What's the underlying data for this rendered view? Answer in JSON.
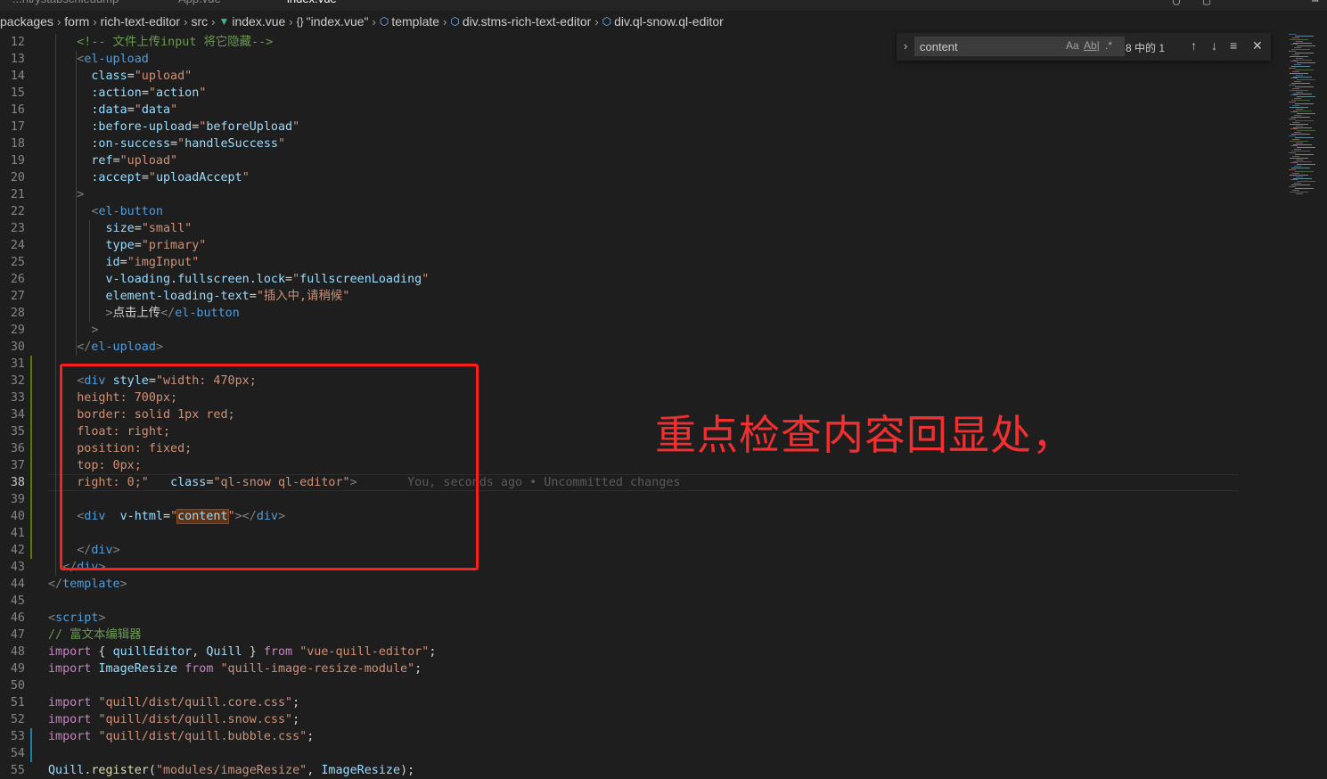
{
  "tabs": [
    {
      "label": "...nt/ystabschiedump",
      "active": false
    },
    {
      "label": "App.vue",
      "active": false
    },
    {
      "label": "index.vue",
      "active": true
    }
  ],
  "breadcrumb": [
    {
      "label": "packages",
      "icon": ""
    },
    {
      "label": "form",
      "icon": ""
    },
    {
      "label": "rich-text-editor",
      "icon": ""
    },
    {
      "label": "src",
      "icon": ""
    },
    {
      "label": "index.vue",
      "icon": "vue-icon"
    },
    {
      "label": "\"index.vue\"",
      "icon": "braces-icon"
    },
    {
      "label": "template",
      "icon": "cube-icon"
    },
    {
      "label": "div.stms-rich-text-editor",
      "icon": "cube-icon"
    },
    {
      "label": "div.ql-snow.ql-editor",
      "icon": "cube-icon"
    }
  ],
  "find": {
    "query": "content",
    "match_case": "Aa",
    "whole_word": "Ab|",
    "regex": ".*",
    "count": "8 中的 1",
    "prev": "↑",
    "next": "↓",
    "selection": "≡",
    "close": "✕"
  },
  "annotation": "重点检查内容回显处，",
  "current_line": 38,
  "lines": [
    {
      "n": 12,
      "tokens": [
        [
          "t-cmt",
          "    <!-- 文件上传input 将它隐藏-->"
        ]
      ]
    },
    {
      "n": 13,
      "tokens": [
        [
          "t-plain",
          "    "
        ],
        [
          "t-punct",
          "<"
        ],
        [
          "t-tag",
          "el-upload"
        ]
      ]
    },
    {
      "n": 14,
      "tokens": [
        [
          "t-plain",
          "      "
        ],
        [
          "t-attr",
          "class"
        ],
        [
          "t-plain",
          "="
        ],
        [
          "t-str",
          "\"upload\""
        ]
      ]
    },
    {
      "n": 15,
      "tokens": [
        [
          "t-plain",
          "      "
        ],
        [
          "t-attr",
          ":action"
        ],
        [
          "t-plain",
          "="
        ],
        [
          "t-str",
          "\""
        ],
        [
          "t-attr",
          "action"
        ],
        [
          "t-str",
          "\""
        ]
      ]
    },
    {
      "n": 16,
      "tokens": [
        [
          "t-plain",
          "      "
        ],
        [
          "t-attr",
          ":data"
        ],
        [
          "t-plain",
          "="
        ],
        [
          "t-str",
          "\""
        ],
        [
          "t-attr",
          "data"
        ],
        [
          "t-str",
          "\""
        ]
      ]
    },
    {
      "n": 17,
      "tokens": [
        [
          "t-plain",
          "      "
        ],
        [
          "t-attr",
          ":before-upload"
        ],
        [
          "t-plain",
          "="
        ],
        [
          "t-str",
          "\""
        ],
        [
          "t-attr",
          "beforeUpload"
        ],
        [
          "t-str",
          "\""
        ]
      ]
    },
    {
      "n": 18,
      "tokens": [
        [
          "t-plain",
          "      "
        ],
        [
          "t-attr",
          ":on-success"
        ],
        [
          "t-plain",
          "="
        ],
        [
          "t-str",
          "\""
        ],
        [
          "t-attr",
          "handleSuccess"
        ],
        [
          "t-str",
          "\""
        ]
      ]
    },
    {
      "n": 19,
      "tokens": [
        [
          "t-plain",
          "      "
        ],
        [
          "t-attr",
          "ref"
        ],
        [
          "t-plain",
          "="
        ],
        [
          "t-str",
          "\"upload\""
        ]
      ]
    },
    {
      "n": 20,
      "tokens": [
        [
          "t-plain",
          "      "
        ],
        [
          "t-attr",
          ":accept"
        ],
        [
          "t-plain",
          "="
        ],
        [
          "t-str",
          "\""
        ],
        [
          "t-attr",
          "uploadAccept"
        ],
        [
          "t-str",
          "\""
        ]
      ]
    },
    {
      "n": 21,
      "tokens": [
        [
          "t-plain",
          "    "
        ],
        [
          "t-punct",
          ">"
        ]
      ]
    },
    {
      "n": 22,
      "tokens": [
        [
          "t-plain",
          "      "
        ],
        [
          "t-punct",
          "<"
        ],
        [
          "t-tag",
          "el-button"
        ]
      ]
    },
    {
      "n": 23,
      "tokens": [
        [
          "t-plain",
          "        "
        ],
        [
          "t-attr",
          "size"
        ],
        [
          "t-plain",
          "="
        ],
        [
          "t-str",
          "\"small\""
        ]
      ]
    },
    {
      "n": 24,
      "tokens": [
        [
          "t-plain",
          "        "
        ],
        [
          "t-attr",
          "type"
        ],
        [
          "t-plain",
          "="
        ],
        [
          "t-str",
          "\"primary\""
        ]
      ]
    },
    {
      "n": 25,
      "tokens": [
        [
          "t-plain",
          "        "
        ],
        [
          "t-attr",
          "id"
        ],
        [
          "t-plain",
          "="
        ],
        [
          "t-str",
          "\"imgInput\""
        ]
      ]
    },
    {
      "n": 26,
      "tokens": [
        [
          "t-plain",
          "        "
        ],
        [
          "t-attr",
          "v-loading.fullscreen.lock"
        ],
        [
          "t-plain",
          "="
        ],
        [
          "t-str",
          "\""
        ],
        [
          "t-attr",
          "fullscreenLoading"
        ],
        [
          "t-str",
          "\""
        ]
      ]
    },
    {
      "n": 27,
      "tokens": [
        [
          "t-plain",
          "        "
        ],
        [
          "t-attr",
          "element-loading-text"
        ],
        [
          "t-plain",
          "="
        ],
        [
          "t-str",
          "\"插入中,请稍候\""
        ]
      ]
    },
    {
      "n": 28,
      "tokens": [
        [
          "t-plain",
          "        "
        ],
        [
          "t-punct",
          ">"
        ],
        [
          "t-plain",
          "点击上传"
        ],
        [
          "t-punct",
          "</"
        ],
        [
          "t-tag",
          "el-button"
        ]
      ]
    },
    {
      "n": 29,
      "tokens": [
        [
          "t-plain",
          "      "
        ],
        [
          "t-punct",
          ">"
        ]
      ]
    },
    {
      "n": 30,
      "tokens": [
        [
          "t-plain",
          "    "
        ],
        [
          "t-punct",
          "</"
        ],
        [
          "t-tag",
          "el-upload"
        ],
        [
          "t-punct",
          ">"
        ]
      ]
    },
    {
      "n": 31,
      "tokens": []
    },
    {
      "n": 32,
      "tokens": [
        [
          "t-plain",
          "    "
        ],
        [
          "t-punct",
          "<"
        ],
        [
          "t-tag",
          "div"
        ],
        [
          "t-plain",
          " "
        ],
        [
          "t-attr",
          "style"
        ],
        [
          "t-plain",
          "="
        ],
        [
          "t-str",
          "\"width: 470px;"
        ]
      ]
    },
    {
      "n": 33,
      "tokens": [
        [
          "t-str",
          "    height: 700px;"
        ]
      ]
    },
    {
      "n": 34,
      "tokens": [
        [
          "t-str",
          "    border: solid 1px red;"
        ]
      ]
    },
    {
      "n": 35,
      "tokens": [
        [
          "t-str",
          "    float: right;"
        ]
      ]
    },
    {
      "n": 36,
      "tokens": [
        [
          "t-str",
          "    position: fixed;"
        ]
      ]
    },
    {
      "n": 37,
      "tokens": [
        [
          "t-str",
          "    top: 0px;"
        ]
      ]
    },
    {
      "n": 38,
      "tokens": [
        [
          "t-str",
          "    right: 0;\""
        ],
        [
          "t-plain",
          "   "
        ],
        [
          "t-attr",
          "class"
        ],
        [
          "t-plain",
          "="
        ],
        [
          "t-str",
          "\"ql-snow ql-editor\""
        ],
        [
          "t-punct",
          ">"
        ],
        [
          "blame",
          "       You, seconds ago • Uncommitted changes"
        ]
      ]
    },
    {
      "n": 39,
      "tokens": []
    },
    {
      "n": 40,
      "tokens": [
        [
          "t-plain",
          "    "
        ],
        [
          "t-punct",
          "<"
        ],
        [
          "t-tag",
          "div"
        ],
        [
          "t-plain",
          "  "
        ],
        [
          "t-attr",
          "v-html"
        ],
        [
          "t-plain",
          "="
        ],
        [
          "t-str",
          "\""
        ],
        [
          "t-attr hl-match",
          "content"
        ],
        [
          "t-str",
          "\""
        ],
        [
          "t-punct",
          "></"
        ],
        [
          "t-tag",
          "div"
        ],
        [
          "t-punct",
          ">"
        ]
      ]
    },
    {
      "n": 41,
      "tokens": []
    },
    {
      "n": 42,
      "tokens": [
        [
          "t-plain",
          "    "
        ],
        [
          "t-punct",
          "</"
        ],
        [
          "t-tag",
          "div"
        ],
        [
          "t-punct",
          ">"
        ]
      ]
    },
    {
      "n": 43,
      "tokens": [
        [
          "t-plain",
          "  "
        ],
        [
          "t-punct",
          "</"
        ],
        [
          "t-tag",
          "div"
        ],
        [
          "t-punct",
          ">"
        ]
      ]
    },
    {
      "n": 44,
      "tokens": [
        [
          "t-punct",
          "</"
        ],
        [
          "t-tag",
          "template"
        ],
        [
          "t-punct",
          ">"
        ]
      ]
    },
    {
      "n": 45,
      "tokens": []
    },
    {
      "n": 46,
      "tokens": [
        [
          "t-punct",
          "<"
        ],
        [
          "t-tag",
          "script"
        ],
        [
          "t-punct",
          ">"
        ]
      ]
    },
    {
      "n": 47,
      "tokens": [
        [
          "t-cmt",
          "// 富文本编辑器"
        ]
      ]
    },
    {
      "n": 48,
      "tokens": [
        [
          "t-kw",
          "import"
        ],
        [
          "t-plain",
          " { "
        ],
        [
          "t-cls",
          "quillEditor"
        ],
        [
          "t-plain",
          ", "
        ],
        [
          "t-cls",
          "Quill"
        ],
        [
          "t-plain",
          " } "
        ],
        [
          "t-kw",
          "from"
        ],
        [
          "t-plain",
          " "
        ],
        [
          "t-str",
          "\"vue-quill-editor\""
        ],
        [
          "t-plain",
          ";"
        ]
      ]
    },
    {
      "n": 49,
      "tokens": [
        [
          "t-kw",
          "import"
        ],
        [
          "t-plain",
          " "
        ],
        [
          "t-cls",
          "ImageResize"
        ],
        [
          "t-plain",
          " "
        ],
        [
          "t-kw",
          "from"
        ],
        [
          "t-plain",
          " "
        ],
        [
          "t-str",
          "\"quill-image-resize-module\""
        ],
        [
          "t-plain",
          ";"
        ]
      ]
    },
    {
      "n": 50,
      "tokens": []
    },
    {
      "n": 51,
      "tokens": [
        [
          "t-kw",
          "import"
        ],
        [
          "t-plain",
          " "
        ],
        [
          "t-str",
          "\"quill/dist/quill.core.css\""
        ],
        [
          "t-plain",
          ";"
        ]
      ]
    },
    {
      "n": 52,
      "tokens": [
        [
          "t-kw",
          "import"
        ],
        [
          "t-plain",
          " "
        ],
        [
          "t-str",
          "\"quill/dist/quill.snow.css\""
        ],
        [
          "t-plain",
          ";"
        ]
      ]
    },
    {
      "n": 53,
      "tokens": [
        [
          "t-kw",
          "import"
        ],
        [
          "t-plain",
          " "
        ],
        [
          "t-str",
          "\"quill/dist/quill.bubble.css\""
        ],
        [
          "t-plain",
          ";"
        ]
      ]
    },
    {
      "n": 54,
      "tokens": []
    },
    {
      "n": 55,
      "tokens": [
        [
          "t-cls",
          "Quill"
        ],
        [
          "t-plain",
          "."
        ],
        [
          "t-fn",
          "register"
        ],
        [
          "t-plain",
          "("
        ],
        [
          "t-str",
          "\"modules/imageResize\""
        ],
        [
          "t-plain",
          ", "
        ],
        [
          "t-cls",
          "ImageResize"
        ],
        [
          "t-plain",
          ");"
        ]
      ]
    }
  ]
}
